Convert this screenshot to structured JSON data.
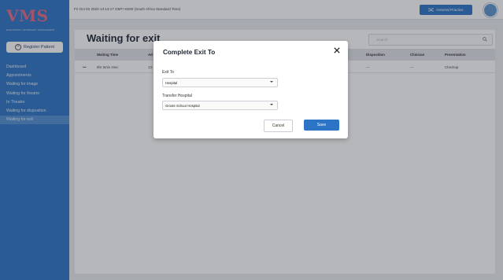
{
  "app": {
    "logo_text": "VMS",
    "logo_subtitle": "ELECTRONIC VETERINARY MANAGEMENT"
  },
  "topbar": {
    "datetime": "Fri Oct 02 2020 13:13:17 GMT+0200 (South Africa Standard Time)",
    "practice_button": "General Practice",
    "practice_icon": "shuffle-icon",
    "avatar_icon": "user-avatar"
  },
  "sidebar": {
    "register_button": "Register Patient",
    "register_icon": "plus-circle-icon",
    "items": [
      {
        "label": "Dashboard"
      },
      {
        "label": "Appointments"
      },
      {
        "label": "Waiting for image"
      },
      {
        "label": "Waiting for theatre"
      },
      {
        "label": "In Theatre"
      },
      {
        "label": "Waiting for disposition"
      },
      {
        "label": "Waiting for exit"
      }
    ],
    "active_index": 6
  },
  "main": {
    "title": "Waiting for exit",
    "search_placeholder": "Search",
    "columns": [
      "Waiting Time",
      "Ad",
      "Disposition",
      "Clinician",
      "Presentation"
    ],
    "rows": [
      {
        "menu": "•••",
        "waiting_time": "9hr 5min 4sec",
        "ad": "13:",
        "disposition": "---",
        "clinician": "---",
        "presentation": "Checkup"
      }
    ]
  },
  "modal": {
    "title": "Complete Exit To",
    "close_icon": "close-icon",
    "exit_to_label": "Exit To",
    "exit_to_value": "Hospital",
    "transfer_label": "Transfer Hospital",
    "transfer_value": "Groote Schuur Hospital",
    "cancel_label": "Cancel",
    "save_label": "Save"
  },
  "colors": {
    "brand": "#2b74c6",
    "logo_accent": "#e36a86",
    "overlay": "rgba(40,44,52,0.34)"
  }
}
